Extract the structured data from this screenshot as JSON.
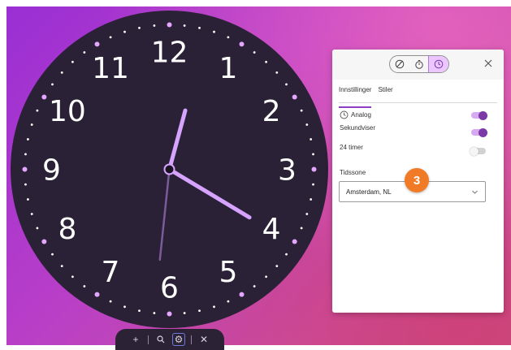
{
  "clock": {
    "numerals": [
      "12",
      "1",
      "2",
      "3",
      "4",
      "5",
      "6",
      "7",
      "8",
      "9",
      "10",
      "11"
    ],
    "time": {
      "hour": 4,
      "minute": 2,
      "second": 31
    },
    "face_color": "#2b2136",
    "hand_color": "#d6a3ff",
    "second_hand_color": "#7b5c9a",
    "accent_dot_color": "#e4a6ff"
  },
  "toolbar": {
    "items": [
      {
        "name": "add-icon",
        "glyph": "+"
      },
      {
        "name": "zoom-icon",
        "glyph": "⚲"
      },
      {
        "name": "settings-icon",
        "glyph": "⚙"
      },
      {
        "name": "close-icon",
        "glyph": "✕"
      }
    ]
  },
  "panel": {
    "mode_buttons": [
      "analog-clock-icon",
      "timer-icon",
      "clock-icon"
    ],
    "active_mode": "clock-icon",
    "tabs": [
      {
        "label": "Innstillinger",
        "active": true
      },
      {
        "label": "Stiler",
        "active": false
      }
    ],
    "settings": [
      {
        "label": "Analog",
        "icon": "clock-icon",
        "on": true
      },
      {
        "label": "Sekundviser",
        "on": true
      },
      {
        "label": "24 timer",
        "on": false
      }
    ],
    "timezone_label": "Tidssone",
    "timezone_value": "Amsterdam, NL",
    "accent": "#8e3ec2"
  },
  "step_badge": "3"
}
